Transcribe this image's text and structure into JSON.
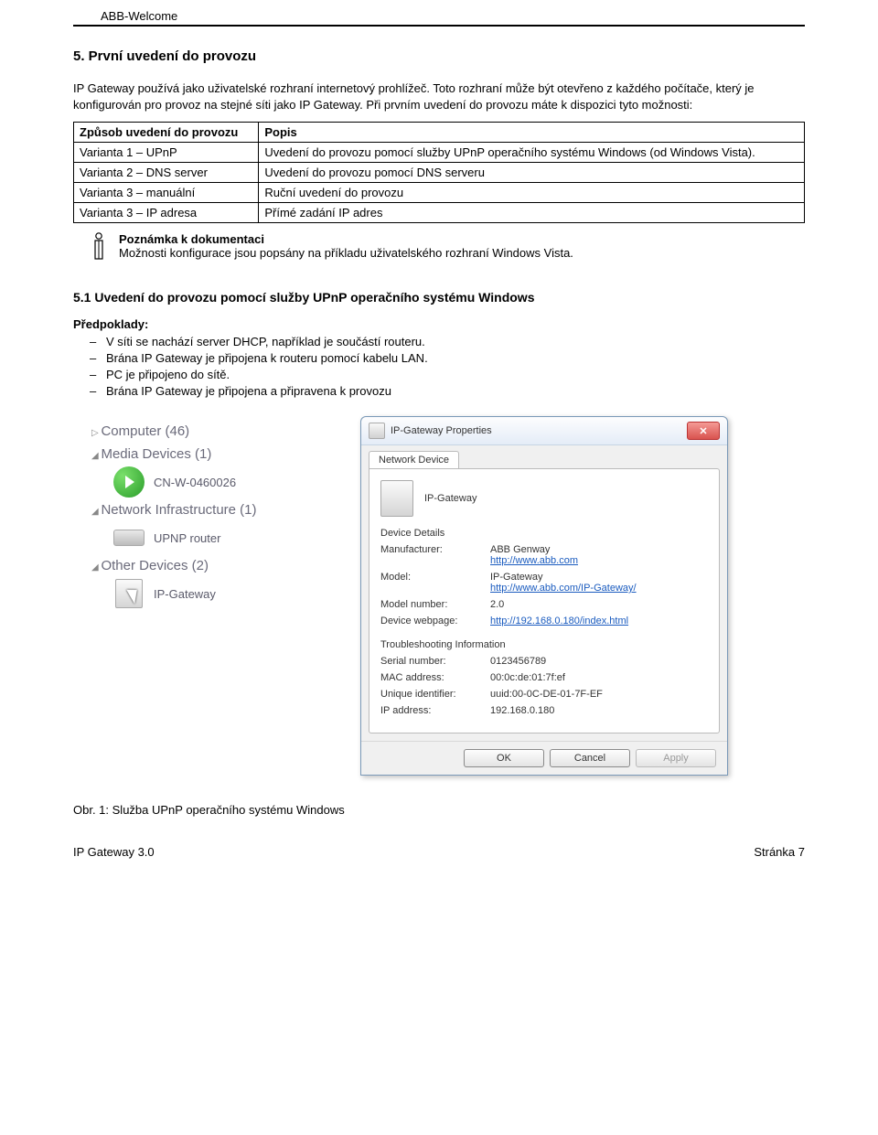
{
  "doc_header": "ABB-Welcome",
  "section_title": "5. První uvedení do provozu",
  "intro": "IP Gateway používá jako uživatelské rozhraní internetový prohlížeč. Toto rozhraní může být otevřeno z každého počítače, který je konfigurován pro provoz na stejné síti jako IP Gateway. Při prvním uvedení do provozu máte k dispozici tyto možnosti:",
  "table": {
    "head": [
      "Způsob uvedení do provozu",
      "Popis"
    ],
    "rows": [
      [
        "Varianta 1 – UPnP",
        "Uvedení do provozu pomocí služby UPnP operačního systému Windows (od Windows Vista)."
      ],
      [
        "Varianta 2 – DNS server",
        "Uvedení do provozu pomocí DNS serveru"
      ],
      [
        "Varianta 3 – manuální",
        "Ruční uvedení do provozu"
      ],
      [
        "Varianta 3 – IP adresa",
        "Přímé zadání IP adres"
      ]
    ]
  },
  "note_title": "Poznámka k dokumentaci",
  "note_body": "Možnosti konfigurace jsou popsány na příkladu uživatelského rozhraní Windows Vista.",
  "subsection_title": "5.1 Uvedení do provozu pomocí služby UPnP operačního systému Windows",
  "pre_label": "Předpoklady:",
  "pre_list": [
    "V síti se nachází server DHCP, například je součástí routeru.",
    "Brána IP Gateway je připojena k routeru pomocí kabelu LAN.",
    "PC je připojeno do sítě.",
    "Brána IP Gateway je připojena a připravena k provozu"
  ],
  "net_pane": {
    "cat1": "Computer (46)",
    "cat2": "Media Devices (1)",
    "item2": "CN-W-0460026",
    "cat3": "Network Infrastructure (1)",
    "item3": "UPNP router",
    "cat4": "Other Devices (2)",
    "item4": "IP-Gateway"
  },
  "dialog": {
    "title": "IP-Gateway Properties",
    "tab": "Network Device",
    "device_name": "IP-Gateway",
    "section1": "Device Details",
    "manufacturer_k": "Manufacturer:",
    "manufacturer_v": "ABB Genway",
    "manufacturer_link": "http://www.abb.com",
    "model_k": "Model:",
    "model_v": "IP-Gateway",
    "model_link": "http://www.abb.com/IP-Gateway/",
    "modelnum_k": "Model number:",
    "modelnum_v": "2.0",
    "webpage_k": "Device webpage:",
    "webpage_link": "http://192.168.0.180/index.html",
    "section2": "Troubleshooting Information",
    "serial_k": "Serial number:",
    "serial_v": "0123456789",
    "mac_k": "MAC address:",
    "mac_v": "00:0c:de:01:7f:ef",
    "uid_k": "Unique identifier:",
    "uid_v": "uuid:00-0C-DE-01-7F-EF",
    "ip_k": "IP address:",
    "ip_v": "192.168.0.180",
    "btn_ok": "OK",
    "btn_cancel": "Cancel",
    "btn_apply": "Apply"
  },
  "figure_caption": "Obr. 1:   Služba UPnP operačního systému Windows",
  "footer_left": "IP Gateway 3.0",
  "footer_right": "Stránka 7"
}
